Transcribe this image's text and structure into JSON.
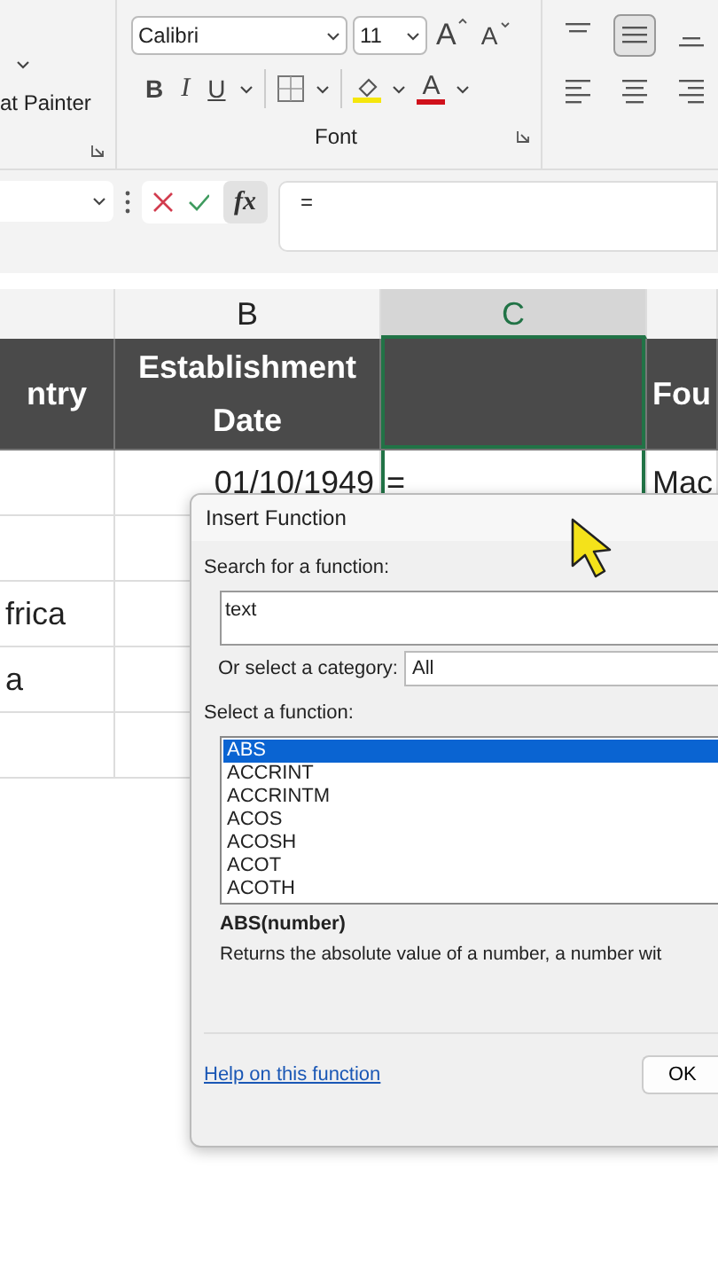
{
  "ribbon": {
    "clipboard": {
      "format_painter": "at Painter"
    },
    "font": {
      "name": "Calibri",
      "size": "11",
      "grow": "A",
      "shrink": "A",
      "bold": "B",
      "italic": "I",
      "underline": "U",
      "font_color": "A",
      "label": "Font"
    },
    "alignment": [
      {
        "kind": "top",
        "selected": false
      },
      {
        "kind": "middle",
        "selected": true
      },
      {
        "kind": "bottom",
        "selected": false
      },
      {
        "kind": "left",
        "selected": false
      },
      {
        "kind": "center",
        "selected": false
      },
      {
        "kind": "right",
        "selected": false
      }
    ]
  },
  "formula_bar": {
    "fx": "fx",
    "value": "="
  },
  "columns": [
    {
      "selected": false
    },
    {
      "label": "B",
      "selected": false
    },
    {
      "label": "C",
      "selected": true
    },
    {
      "selected": false
    }
  ],
  "rows": [
    {
      "kind": "header",
      "cells": [
        {
          "text": "ntry",
          "selected": false
        },
        {
          "text": "Establishment Date",
          "selected": false
        },
        {
          "selected": true
        },
        {
          "text": "Fou",
          "selected": false
        }
      ]
    },
    {
      "kind": "data",
      "cells": [
        {
          "selected": false
        },
        {
          "text": "01/10/1949",
          "selected": false
        },
        {
          "text": "=",
          "selected": true
        },
        {
          "text": "Mac",
          "selected": false
        }
      ]
    },
    {
      "kind": "data",
      "cells": [
        {
          "selected": false
        },
        {
          "selected": false
        }
      ]
    },
    {
      "kind": "data",
      "cells": [
        {
          "text": "frica",
          "selected": false
        },
        {
          "selected": false
        }
      ]
    },
    {
      "kind": "data",
      "cells": [
        {
          "text": "a",
          "selected": false
        },
        {
          "selected": false
        }
      ]
    },
    {
      "kind": "data",
      "cells": [
        {
          "selected": false
        },
        {
          "selected": false
        }
      ]
    }
  ],
  "dialog": {
    "title": "Insert Function",
    "search_label": "Search for a function:",
    "search_value": "text",
    "category_label": "Or select a category:",
    "category_value": "All",
    "list_label": "Select a function:",
    "functions": [
      {
        "name": "ABS",
        "selected": true
      },
      {
        "name": "ACCRINT",
        "selected": false
      },
      {
        "name": "ACCRINTM",
        "selected": false
      },
      {
        "name": "ACOS",
        "selected": false
      },
      {
        "name": "ACOSH",
        "selected": false
      },
      {
        "name": "ACOT",
        "selected": false
      },
      {
        "name": "ACOTH",
        "selected": false
      }
    ],
    "signature": "ABS(number)",
    "description": "Returns the absolute value of a number, a number wit",
    "help_link": "Help on this function",
    "ok": "OK"
  }
}
